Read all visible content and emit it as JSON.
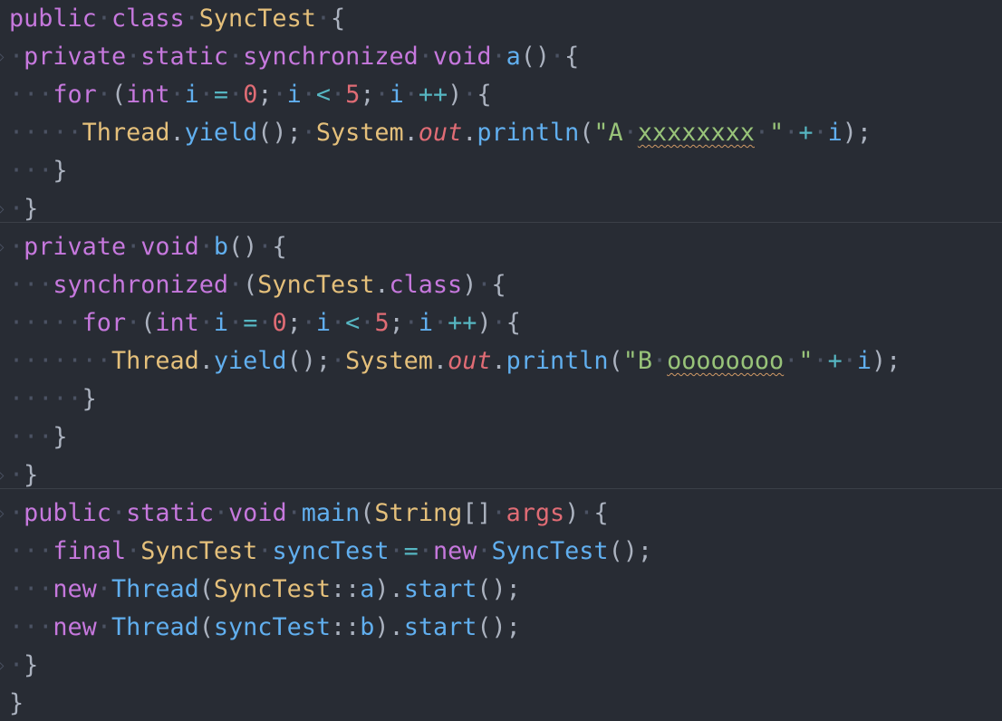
{
  "code": {
    "lines": [
      {
        "indent": "",
        "tokens": [
          [
            "kw",
            "public"
          ],
          [
            "ws",
            "·"
          ],
          [
            "kw",
            "class"
          ],
          [
            "ws",
            "·"
          ],
          [
            "cls",
            "SyncTest"
          ],
          [
            "ws",
            "·"
          ],
          [
            "pun",
            "{"
          ]
        ]
      },
      {
        "indent": "·",
        "tokens": [
          [
            "kw",
            "private"
          ],
          [
            "ws",
            "·"
          ],
          [
            "kw",
            "static"
          ],
          [
            "ws",
            "·"
          ],
          [
            "kw",
            "synchronized"
          ],
          [
            "ws",
            "·"
          ],
          [
            "kw",
            "void"
          ],
          [
            "ws",
            "·"
          ],
          [
            "fn",
            "a"
          ],
          [
            "pun",
            "()"
          ],
          [
            "ws",
            "·"
          ],
          [
            "pun",
            "{"
          ]
        ]
      },
      {
        "indent": "···",
        "tokens": [
          [
            "kw",
            "for"
          ],
          [
            "ws",
            "·"
          ],
          [
            "pun",
            "("
          ],
          [
            "kw",
            "int"
          ],
          [
            "ws",
            "·"
          ],
          [
            "var",
            "i"
          ],
          [
            "ws",
            "·"
          ],
          [
            "op",
            "="
          ],
          [
            "ws",
            "·"
          ],
          [
            "num",
            "0"
          ],
          [
            "pun",
            ";"
          ],
          [
            "ws",
            "·"
          ],
          [
            "var",
            "i"
          ],
          [
            "ws",
            "·"
          ],
          [
            "op",
            "<"
          ],
          [
            "ws",
            "·"
          ],
          [
            "num",
            "5"
          ],
          [
            "pun",
            ";"
          ],
          [
            "ws",
            "·"
          ],
          [
            "var",
            "i"
          ],
          [
            "ws",
            "·"
          ],
          [
            "op",
            "++"
          ],
          [
            "pun",
            ")"
          ],
          [
            "ws",
            "·"
          ],
          [
            "pun",
            "{"
          ]
        ]
      },
      {
        "indent": "·····",
        "tokens": [
          [
            "cls",
            "Thread"
          ],
          [
            "pun",
            "."
          ],
          [
            "fn",
            "yield"
          ],
          [
            "pun",
            "();"
          ],
          [
            "ws",
            "·"
          ],
          [
            "cls",
            "System"
          ],
          [
            "pun",
            "."
          ],
          [
            "fld",
            "out"
          ],
          [
            "pun",
            "."
          ],
          [
            "fn",
            "println"
          ],
          [
            "pun",
            "("
          ],
          [
            "str",
            "\"A"
          ],
          [
            "ws",
            "·"
          ],
          [
            "strsq",
            "xxxxxxxx"
          ],
          [
            "ws",
            "·"
          ],
          [
            "str",
            "\""
          ],
          [
            "ws",
            "·"
          ],
          [
            "op",
            "+"
          ],
          [
            "ws",
            "·"
          ],
          [
            "var",
            "i"
          ],
          [
            "pun",
            ");"
          ]
        ]
      },
      {
        "indent": "···",
        "tokens": [
          [
            "pun",
            "}"
          ]
        ]
      },
      {
        "indent": "·",
        "tokens": [
          [
            "pun",
            "}"
          ]
        ]
      },
      {
        "indent": "·",
        "tokens": [
          [
            "kw",
            "private"
          ],
          [
            "ws",
            "·"
          ],
          [
            "kw",
            "void"
          ],
          [
            "ws",
            "·"
          ],
          [
            "fn",
            "b"
          ],
          [
            "pun",
            "()"
          ],
          [
            "ws",
            "·"
          ],
          [
            "pun",
            "{"
          ]
        ]
      },
      {
        "indent": "···",
        "tokens": [
          [
            "kw",
            "synchronized"
          ],
          [
            "ws",
            "·"
          ],
          [
            "pun",
            "("
          ],
          [
            "cls",
            "SyncTest"
          ],
          [
            "pun",
            "."
          ],
          [
            "kw",
            "class"
          ],
          [
            "pun",
            ")"
          ],
          [
            "ws",
            "·"
          ],
          [
            "pun",
            "{"
          ]
        ]
      },
      {
        "indent": "·····",
        "tokens": [
          [
            "kw",
            "for"
          ],
          [
            "ws",
            "·"
          ],
          [
            "pun",
            "("
          ],
          [
            "kw",
            "int"
          ],
          [
            "ws",
            "·"
          ],
          [
            "var",
            "i"
          ],
          [
            "ws",
            "·"
          ],
          [
            "op",
            "="
          ],
          [
            "ws",
            "·"
          ],
          [
            "num",
            "0"
          ],
          [
            "pun",
            ";"
          ],
          [
            "ws",
            "·"
          ],
          [
            "var",
            "i"
          ],
          [
            "ws",
            "·"
          ],
          [
            "op",
            "<"
          ],
          [
            "ws",
            "·"
          ],
          [
            "num",
            "5"
          ],
          [
            "pun",
            ";"
          ],
          [
            "ws",
            "·"
          ],
          [
            "var",
            "i"
          ],
          [
            "ws",
            "·"
          ],
          [
            "op",
            "++"
          ],
          [
            "pun",
            ")"
          ],
          [
            "ws",
            "·"
          ],
          [
            "pun",
            "{"
          ]
        ]
      },
      {
        "indent": "·······",
        "tokens": [
          [
            "cls",
            "Thread"
          ],
          [
            "pun",
            "."
          ],
          [
            "fn",
            "yield"
          ],
          [
            "pun",
            "();"
          ],
          [
            "ws",
            "·"
          ],
          [
            "cls",
            "System"
          ],
          [
            "pun",
            "."
          ],
          [
            "fld",
            "out"
          ],
          [
            "pun",
            "."
          ],
          [
            "fn",
            "println"
          ],
          [
            "pun",
            "("
          ],
          [
            "str",
            "\"B"
          ],
          [
            "ws",
            "·"
          ],
          [
            "strsq",
            "oooooooo"
          ],
          [
            "ws",
            "·"
          ],
          [
            "str",
            "\""
          ],
          [
            "ws",
            "·"
          ],
          [
            "op",
            "+"
          ],
          [
            "ws",
            "·"
          ],
          [
            "var",
            "i"
          ],
          [
            "pun",
            ");"
          ]
        ]
      },
      {
        "indent": "·····",
        "tokens": [
          [
            "pun",
            "}"
          ]
        ]
      },
      {
        "indent": "···",
        "tokens": [
          [
            "pun",
            "}"
          ]
        ]
      },
      {
        "indent": "·",
        "tokens": [
          [
            "pun",
            "}"
          ]
        ]
      },
      {
        "indent": "·",
        "tokens": [
          [
            "kw",
            "public"
          ],
          [
            "ws",
            "·"
          ],
          [
            "kw",
            "static"
          ],
          [
            "ws",
            "·"
          ],
          [
            "kw",
            "void"
          ],
          [
            "ws",
            "·"
          ],
          [
            "fn",
            "main"
          ],
          [
            "pun",
            "("
          ],
          [
            "cls",
            "String"
          ],
          [
            "pun",
            "[]"
          ],
          [
            "ws",
            "·"
          ],
          [
            "prm",
            "args"
          ],
          [
            "pun",
            ")"
          ],
          [
            "ws",
            "·"
          ],
          [
            "pun",
            "{"
          ]
        ]
      },
      {
        "indent": "···",
        "tokens": [
          [
            "kw",
            "final"
          ],
          [
            "ws",
            "·"
          ],
          [
            "cls",
            "SyncTest"
          ],
          [
            "ws",
            "·"
          ],
          [
            "var",
            "syncTest"
          ],
          [
            "ws",
            "·"
          ],
          [
            "op",
            "="
          ],
          [
            "ws",
            "·"
          ],
          [
            "kw",
            "new"
          ],
          [
            "ws",
            "·"
          ],
          [
            "typ",
            "SyncTest"
          ],
          [
            "pun",
            "();"
          ]
        ]
      },
      {
        "indent": "···",
        "tokens": [
          [
            "kw",
            "new"
          ],
          [
            "ws",
            "·"
          ],
          [
            "typ",
            "Thread"
          ],
          [
            "pun",
            "("
          ],
          [
            "cls",
            "SyncTest"
          ],
          [
            "pun",
            "::"
          ],
          [
            "var",
            "a"
          ],
          [
            "pun",
            ")."
          ],
          [
            "fn",
            "start"
          ],
          [
            "pun",
            "();"
          ]
        ]
      },
      {
        "indent": "···",
        "tokens": [
          [
            "kw",
            "new"
          ],
          [
            "ws",
            "·"
          ],
          [
            "typ",
            "Thread"
          ],
          [
            "pun",
            "("
          ],
          [
            "var",
            "syncTest"
          ],
          [
            "pun",
            "::"
          ],
          [
            "var",
            "b"
          ],
          [
            "pun",
            ")."
          ],
          [
            "fn",
            "start"
          ],
          [
            "pun",
            "();"
          ]
        ]
      },
      {
        "indent": "·",
        "tokens": [
          [
            "pun",
            "}"
          ]
        ]
      },
      {
        "indent": "",
        "tokens": [
          [
            "pun",
            "}"
          ]
        ]
      }
    ]
  },
  "theme": {
    "background": "#282c34",
    "keyword": "#c678dd",
    "class": "#e5c07b",
    "function": "#61afef",
    "number": "#e06c75",
    "string": "#98c379",
    "operator": "#56b6c2",
    "whitespace": "#4b5263"
  }
}
